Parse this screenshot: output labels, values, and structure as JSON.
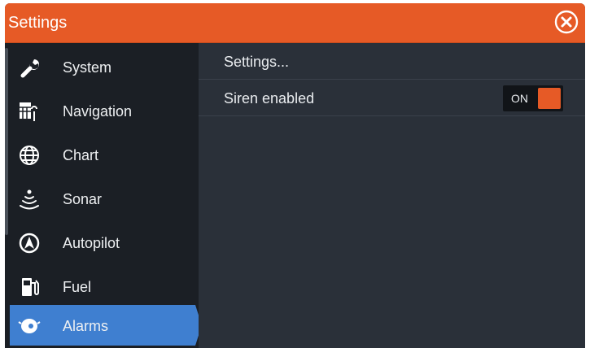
{
  "window": {
    "title": "Settings"
  },
  "sidebar": {
    "items": [
      {
        "label": "System",
        "icon": "wrench-icon"
      },
      {
        "label": "Navigation",
        "icon": "navigation-icon"
      },
      {
        "label": "Chart",
        "icon": "globe-icon"
      },
      {
        "label": "Sonar",
        "icon": "sonar-icon"
      },
      {
        "label": "Autopilot",
        "icon": "autopilot-icon"
      },
      {
        "label": "Fuel",
        "icon": "fuel-pump-icon"
      },
      {
        "label": "Alarms",
        "icon": "alarm-icon",
        "selected": true
      }
    ]
  },
  "content": {
    "rows": [
      {
        "label": "Settings..."
      },
      {
        "label": "Siren enabled",
        "toggle": {
          "state": "ON",
          "on": true
        }
      }
    ]
  },
  "colors": {
    "accent": "#e65a26",
    "selected": "#3f7fd0",
    "sidebar_bg": "#1b1f25",
    "content_bg": "#2a3039"
  }
}
